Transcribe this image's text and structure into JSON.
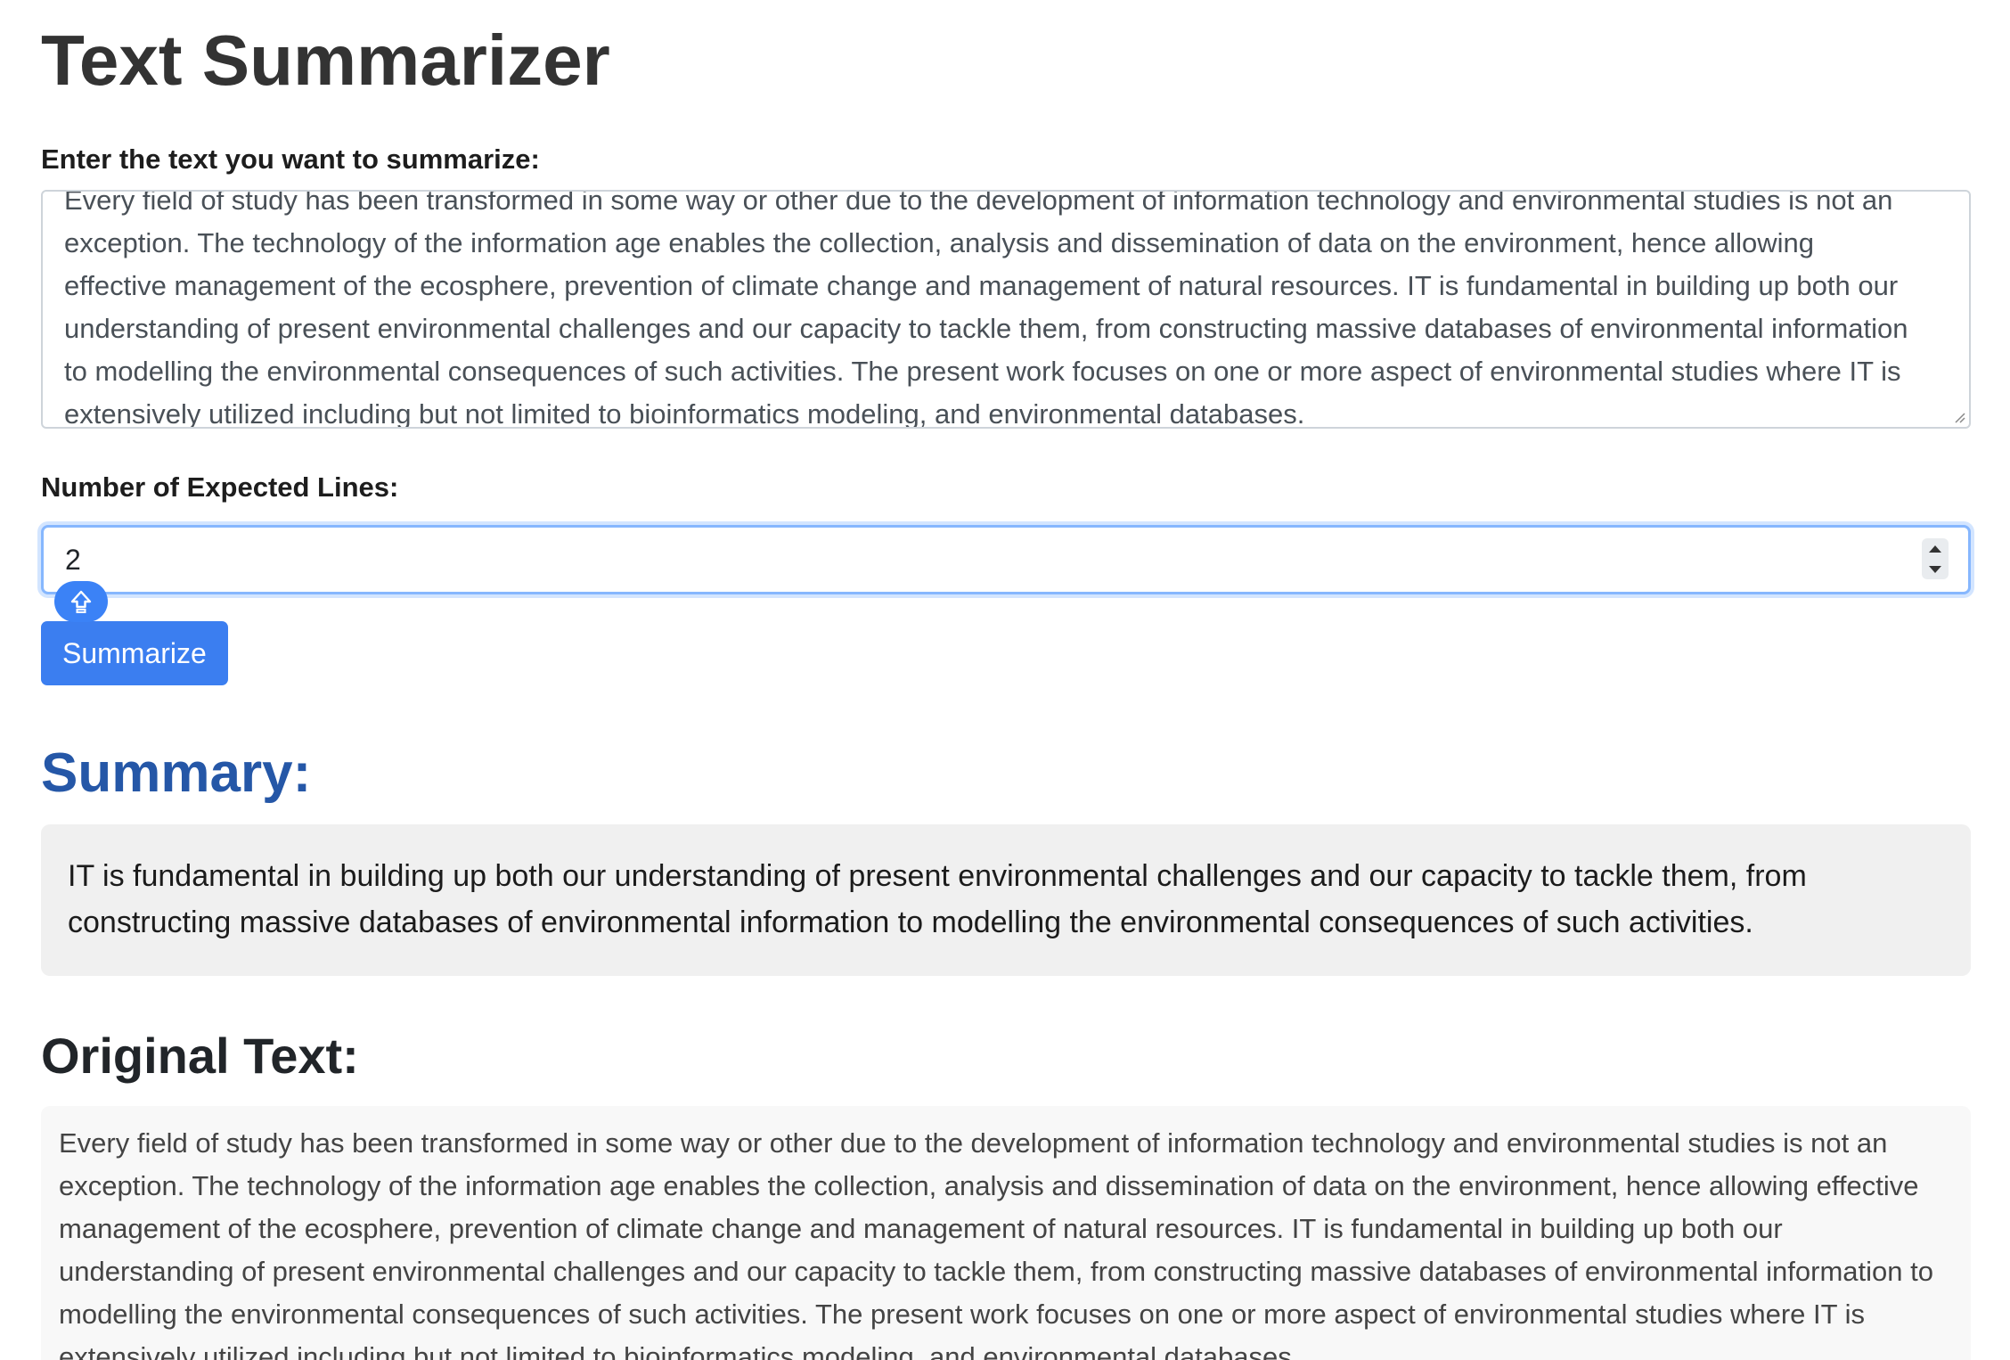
{
  "page": {
    "title": "Text Summarizer"
  },
  "form": {
    "text_label": "Enter the text you want to summarize:",
    "text_value": "Every field of study has been transformed in some way or other due to the development of information technology and environmental studies is not an exception. The technology of the information age enables the collection, analysis and dissemination of data on the environment, hence allowing effective management of the ecosphere, prevention of climate change and management of natural resources. IT is fundamental in building up both our understanding of present environmental challenges and our capacity to tackle them, from constructing massive databases of environmental information to modelling the environmental consequences of such activities. The present work focuses on one or more aspect of environmental studies where IT is extensively utilized including but not limited to bioinformatics modeling, and environmental databases.",
    "lines_label": "Number of Expected Lines:",
    "lines_value": "2",
    "submit_label": "Summarize"
  },
  "summary": {
    "heading": "Summary:",
    "text": "IT is fundamental in building up both our understanding of present environmental challenges and our capacity to tackle them, from constructing massive databases of environmental information to modelling the environmental consequences of such activities."
  },
  "original": {
    "heading": "Original Text:",
    "text": "Every field of study has been transformed in some way or other due to the development of information technology and environmental studies is not an exception. The technology of the information age enables the collection, analysis and dissemination of data on the environment, hence allowing effective management of the ecosphere, prevention of climate change and management of natural resources. IT is fundamental in building up both our understanding of present environmental challenges and our capacity to tackle them, from constructing massive databases of environmental information to modelling the environmental consequences of such activities. The present work focuses on one or more aspect of environmental studies where IT is extensively utilized including but not limited to bioinformatics modeling, and environmental databases."
  },
  "icons": {
    "caps_lock": "caps-lock-icon",
    "resize": "resize-grip-icon"
  },
  "colors": {
    "primary_button": "#3b7ef0",
    "summary_heading": "#2557a7",
    "focus_border": "#86b7fe",
    "summary_bg": "#f0f0f0",
    "original_bg": "#f8f8f8"
  }
}
